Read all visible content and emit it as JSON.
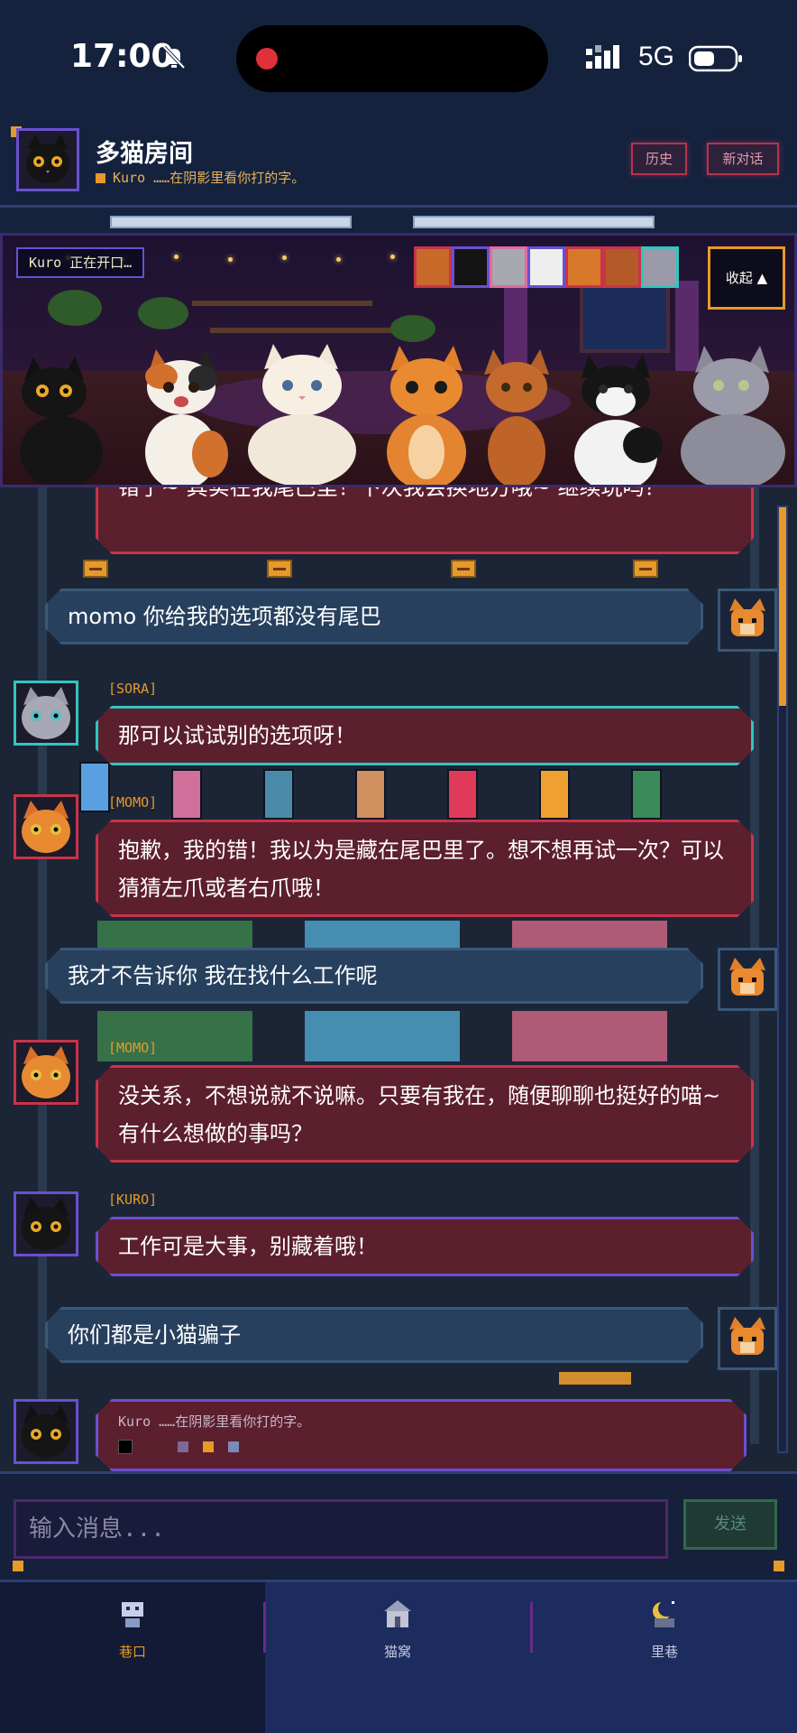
{
  "status_bar": {
    "time": "17:00",
    "network": "5G"
  },
  "header": {
    "title": "多猫房间",
    "subtitle": "Kuro ……在阴影里看你打的字。",
    "history_label": "历史",
    "new_chat_label": "新对话"
  },
  "banner": {
    "typing_status": "Kuro 正在开口…",
    "collapse_label": "收起 ▲",
    "cats": [
      "momo",
      "kuro",
      "sora",
      "mochi",
      "momo",
      "leo",
      "sora"
    ]
  },
  "messages": [
    {
      "from": "cat",
      "text": "错了~ 其实在我尾巴里！下次我会换地方哦~ 继续玩吗？"
    },
    {
      "from": "user",
      "text": "momo 你给我的选项都没有尾巴"
    },
    {
      "from": "cat",
      "name": "[SORA]",
      "text": "那可以试试别的选项呀！"
    },
    {
      "from": "cat",
      "name": "[MOMO]",
      "text": "抱歉，我的错！我以为是藏在尾巴里了。想不想再试一次？可以猜猜左爪或者右爪哦！"
    },
    {
      "from": "user",
      "text": "我才不告诉你  我在找什么工作呢"
    },
    {
      "from": "cat",
      "name": "[MOMO]",
      "text": "没关系，不想说就不说嘛。只要有我在，随便聊聊也挺好的喵~ 有什么想做的事吗？"
    },
    {
      "from": "cat",
      "name": "[KURO]",
      "text": "工作可是大事，别藏着哦！"
    },
    {
      "from": "user",
      "text": "你们都是小猫骗子"
    },
    {
      "from": "cat",
      "text": "Kuro ……在阴影里看你打的字。"
    }
  ],
  "input": {
    "placeholder": "输入消息...",
    "send_label": "发送"
  },
  "nav": [
    {
      "label": "巷口",
      "active": true
    },
    {
      "label": "猫窝",
      "active": false
    },
    {
      "label": "里巷",
      "active": false
    }
  ],
  "colors": {
    "accent": "#e69a2a",
    "cat_bubble": "#5c1f2e",
    "user_bubble": "#27405e"
  }
}
